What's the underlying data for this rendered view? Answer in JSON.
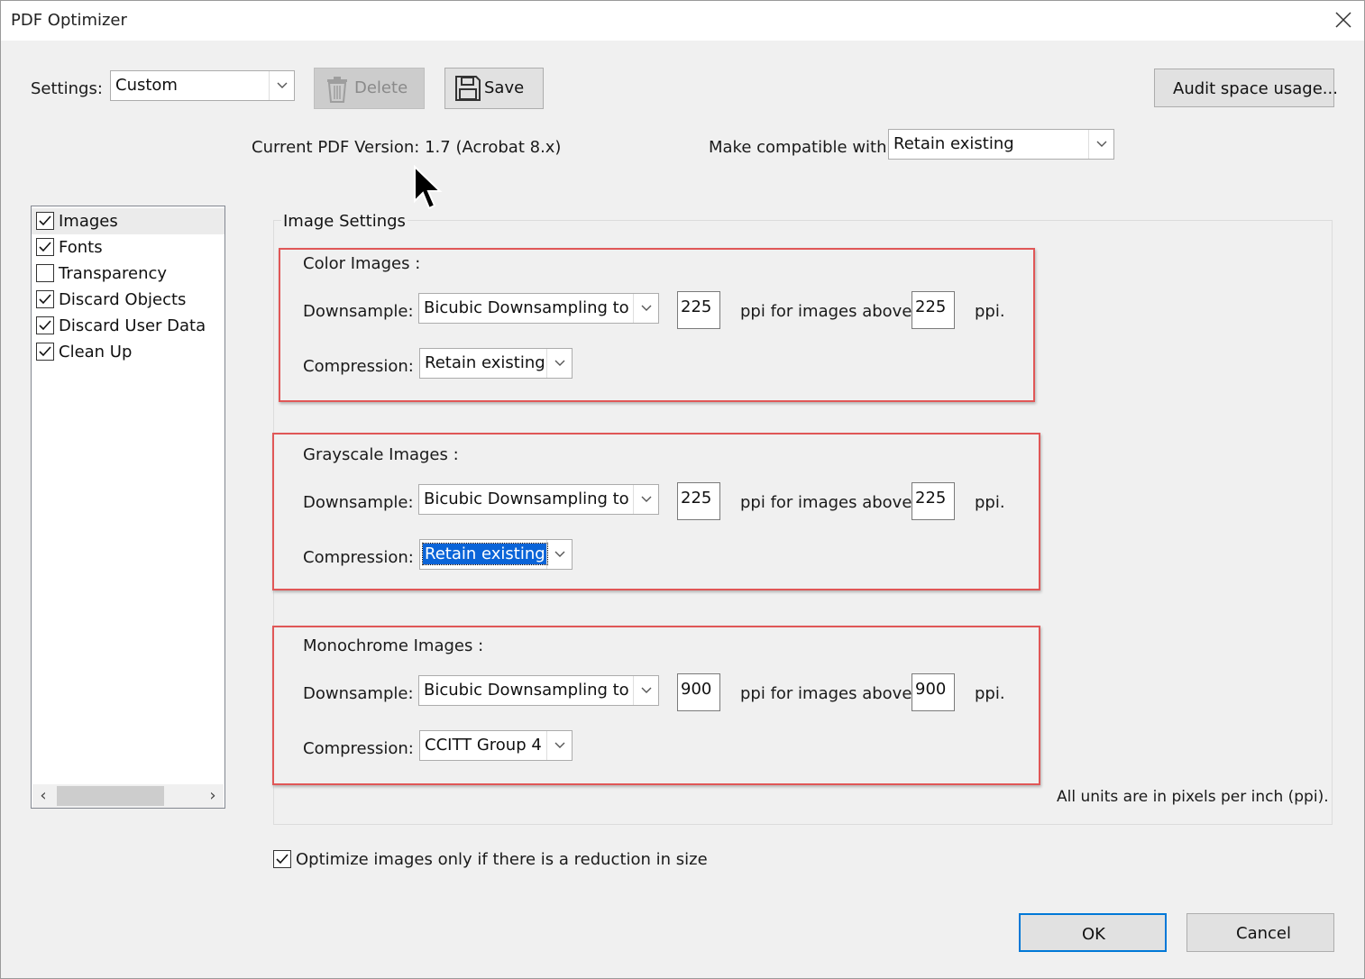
{
  "window": {
    "title": "PDF Optimizer"
  },
  "settings": {
    "label": "Settings:",
    "preset_value": "Custom",
    "delete_label": "Delete",
    "save_label": "Save",
    "audit_label": "Audit space usage..."
  },
  "version": {
    "current_text": "Current PDF Version: 1.7 (Acrobat 8.x)",
    "compatible_label": "Make compatible with:",
    "compatible_value": "Retain existing"
  },
  "sidebar": {
    "items": [
      {
        "label": "Images",
        "checked": true,
        "selected": true
      },
      {
        "label": "Fonts",
        "checked": true
      },
      {
        "label": "Transparency",
        "checked": false
      },
      {
        "label": "Discard Objects",
        "checked": true
      },
      {
        "label": "Discard User Data",
        "checked": true
      },
      {
        "label": "Clean Up",
        "checked": true
      }
    ]
  },
  "image_settings": {
    "title": "Image Settings",
    "sections": [
      {
        "title": "Color Images :",
        "downsample_label": "Downsample:",
        "downsample_method": "Bicubic Downsampling to",
        "target_ppi": "225",
        "above_text": "ppi for images above",
        "threshold_ppi": "225",
        "ppi_suffix": "ppi.",
        "compression_label": "Compression:",
        "compression_value": "Retain existing"
      },
      {
        "title": "Grayscale Images :",
        "downsample_label": "Downsample:",
        "downsample_method": "Bicubic Downsampling to",
        "target_ppi": "225",
        "above_text": "ppi for images above",
        "threshold_ppi": "225",
        "ppi_suffix": "ppi.",
        "compression_label": "Compression:",
        "compression_value": "Retain existing"
      },
      {
        "title": "Monochrome Images :",
        "downsample_label": "Downsample:",
        "downsample_method": "Bicubic Downsampling to",
        "target_ppi": "900",
        "above_text": "ppi for images above",
        "threshold_ppi": "900",
        "ppi_suffix": "ppi.",
        "compression_label": "Compression:",
        "compression_value": "CCITT Group 4"
      }
    ],
    "units_note": "All units are in pixels per inch (ppi)."
  },
  "optimize_only": {
    "label": "Optimize images only if there is a reduction in size",
    "checked": true
  },
  "buttons": {
    "ok": "OK",
    "cancel": "Cancel"
  },
  "colors": {
    "accent": "#0078d7",
    "highlight_box": "#e05757",
    "selection": "#0a64d8"
  },
  "icons": [
    "close-icon",
    "trash-icon",
    "floppy-disk-icon",
    "chevron-down-icon",
    "checkmark-icon",
    "mouse-pointer-icon",
    "chevron-left-icon",
    "chevron-right-icon"
  ]
}
